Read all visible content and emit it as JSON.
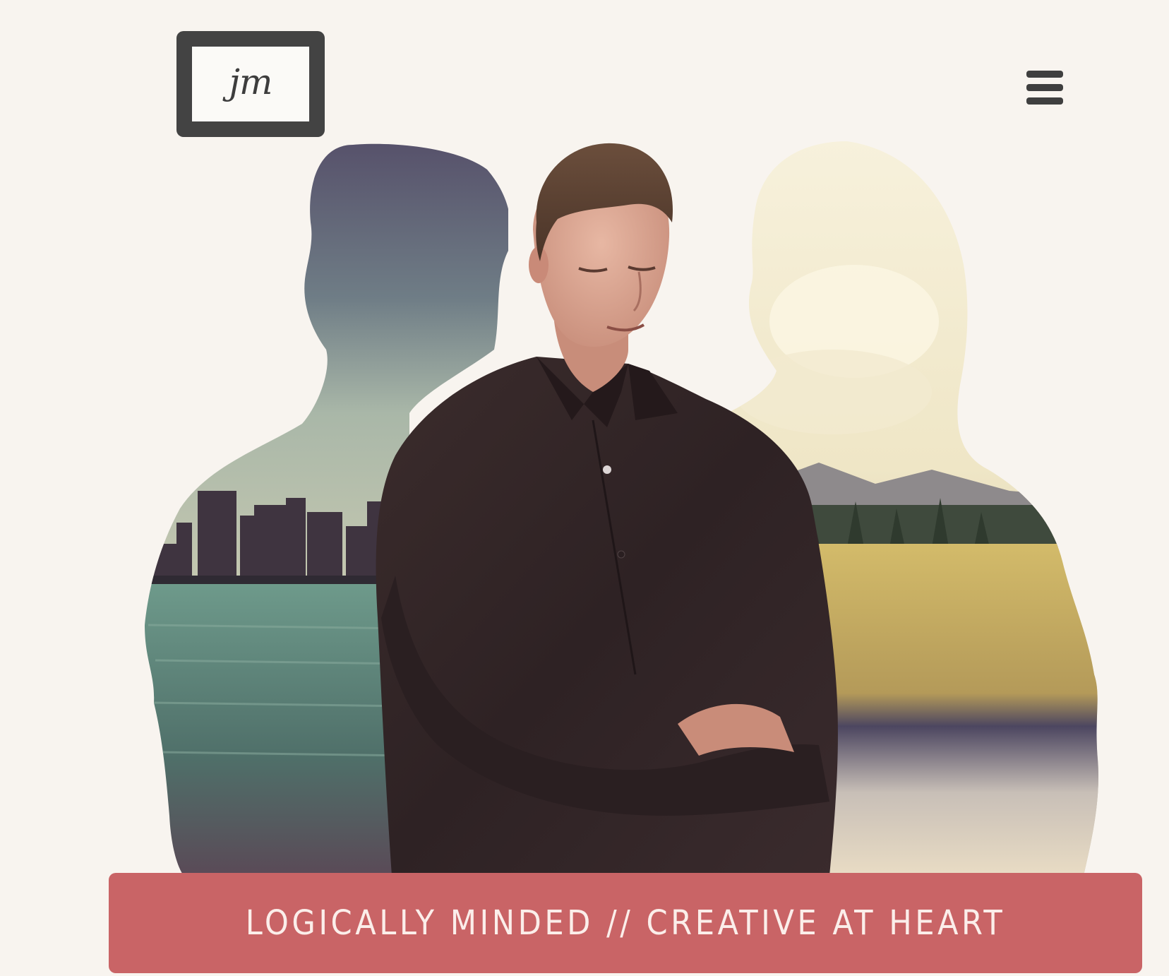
{
  "header": {
    "logo_text": "jm",
    "menu_icon": "hamburger-menu-icon"
  },
  "hero": {
    "description_icon": "portrait-double-exposure-image"
  },
  "tagline": {
    "text": "LOGICALLY MINDED // CREATIVE AT HEART"
  },
  "colors": {
    "background": "#f8f4ef",
    "logo_frame": "#434343",
    "menu_icon": "#3f3f3f",
    "banner": "#c96466",
    "banner_text": "#fbeeea"
  }
}
